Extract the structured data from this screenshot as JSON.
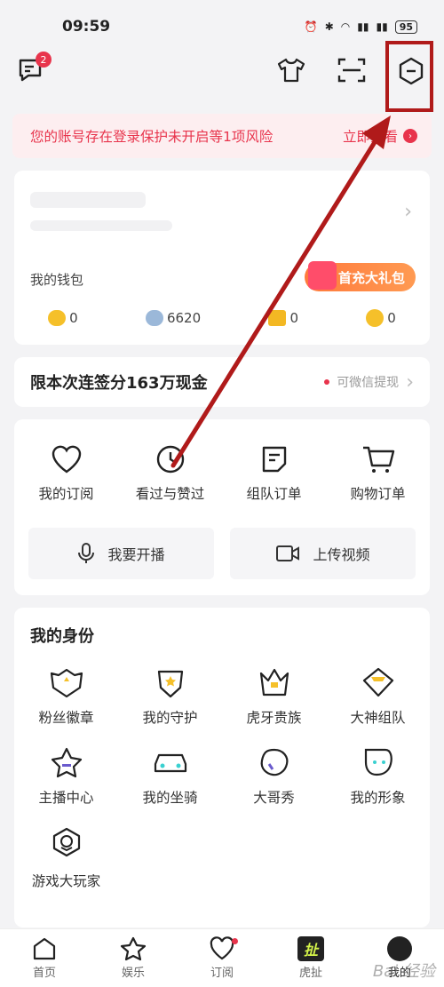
{
  "status_bar": {
    "time": "09:59",
    "battery": "95"
  },
  "topbar": {
    "message_badge": "2"
  },
  "alert": {
    "text": "您的账号存在登录保护未开启等1项风险",
    "link": "立即查看"
  },
  "wallet": {
    "label": "我的钱包",
    "gift_button": "首充大礼包",
    "items": [
      {
        "icon": "yellow-coin-icon",
        "value": "0",
        "color": "#f5c02a"
      },
      {
        "icon": "silver-bean-icon",
        "value": "6620",
        "color": "#9bb8d9"
      },
      {
        "icon": "gold-ticket-icon",
        "value": "0",
        "color": "#f3b823"
      },
      {
        "icon": "gold-bean-icon",
        "value": "0",
        "color": "#f5c02a"
      }
    ]
  },
  "signin": {
    "title": "限本次连签分163万现金",
    "tip": "可微信提现"
  },
  "orders": {
    "items": [
      "我的订阅",
      "看过与赞过",
      "组队订单",
      "购物订单"
    ],
    "actions": [
      "我要开播",
      "上传视频"
    ]
  },
  "identity": {
    "title": "我的身份",
    "items": [
      "粉丝徽章",
      "我的守护",
      "虎牙贵族",
      "大神组队",
      "主播中心",
      "我的坐骑",
      "大哥秀",
      "我的形象",
      "游戏大玩家"
    ]
  },
  "nav": [
    "首页",
    "娱乐",
    "订阅",
    "虎扯",
    "我的"
  ],
  "watermark": "Bai  经验"
}
